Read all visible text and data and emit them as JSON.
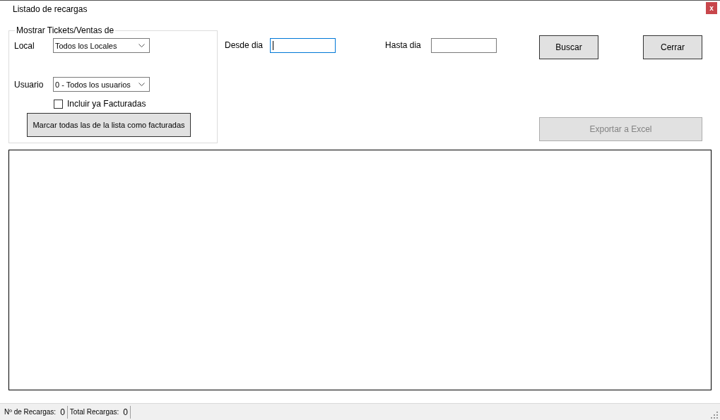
{
  "window": {
    "title": "Listado de recargas",
    "close": "x"
  },
  "filter_group": {
    "title": "Mostrar Tickets/Ventas de",
    "local": {
      "label": "Local",
      "value": "Todos los Locales"
    },
    "user": {
      "label": "Usuario",
      "value": "0 - Todos los usuarios"
    },
    "include_invoiced": {
      "label": "Incluir ya Facturadas",
      "checked": false
    },
    "mark_button": "Marcar todas las de la lista como facturadas"
  },
  "date_from": {
    "label": "Desde dia",
    "focused": true
  },
  "date_to": {
    "label": "Hasta dia",
    "focused": false
  },
  "buttons": [
    {
      "label": "Buscar",
      "disabled": false
    },
    {
      "label": "Cerrar",
      "disabled": false
    }
  ],
  "export_button": {
    "label": "Exportar a Excel",
    "disabled": true
  },
  "status_bar": [
    {
      "label": "Nº de Recargas:",
      "value": "0"
    },
    {
      "label": "Total Recargas:",
      "value": "0"
    }
  ]
}
